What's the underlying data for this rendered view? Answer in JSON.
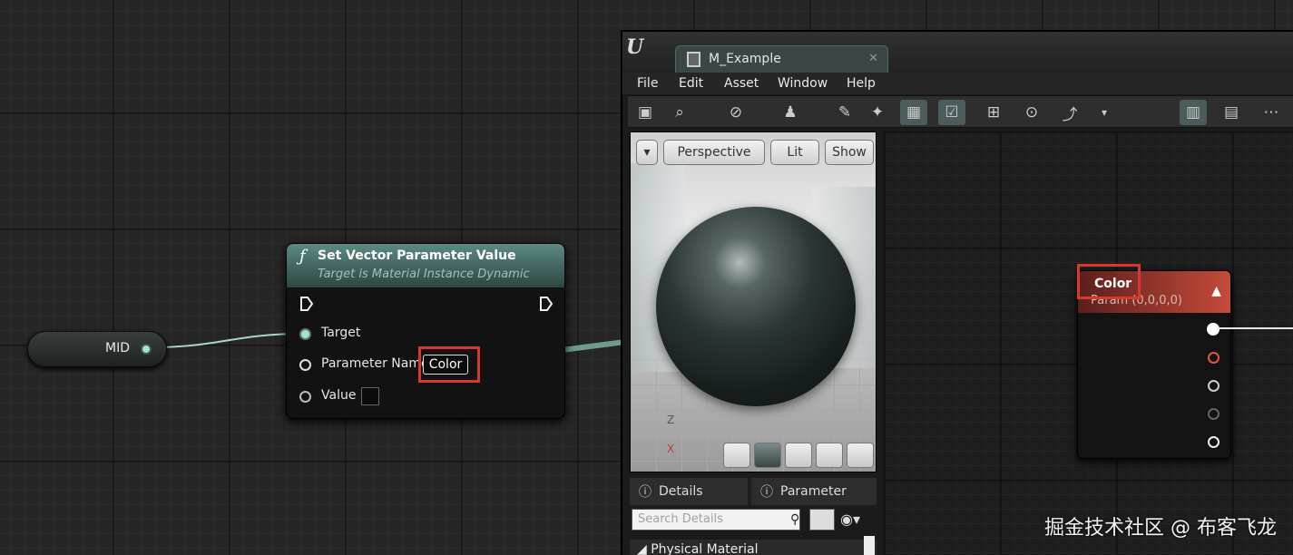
{
  "mid_node": {
    "label": "MID"
  },
  "set_vector_node": {
    "icon": "function-icon",
    "title": "Set Vector Parameter Value",
    "subtitle": "Target is Material Instance Dynamic",
    "pins": {
      "target": "Target",
      "parameter_name": "Parameter Name",
      "value": "Value"
    },
    "parameter_name_value": "Color"
  },
  "material_editor": {
    "tab_label": "M_Example",
    "menu": [
      "File",
      "Edit",
      "Asset",
      "Window",
      "Help"
    ],
    "viewport": {
      "perspective_label": "Perspective",
      "lit_label": "Lit",
      "show_label": "Show",
      "axis_z": "Z",
      "axis_x": "X"
    },
    "panels": {
      "details_tab": "Details",
      "parameter_tab": "Parameter",
      "search_placeholder": "Search Details",
      "section": "Physical Material"
    }
  },
  "color_node": {
    "title": "Color",
    "default_value": "Param (0,0,0,0)"
  },
  "watermark": "掘金技术社区 @ 布客飞龙",
  "colors": {
    "highlight_red": "#d9392c",
    "node_header_teal": "#5d8a84",
    "param_header_red": "#c54b3a",
    "wire": "#6e9a90"
  }
}
